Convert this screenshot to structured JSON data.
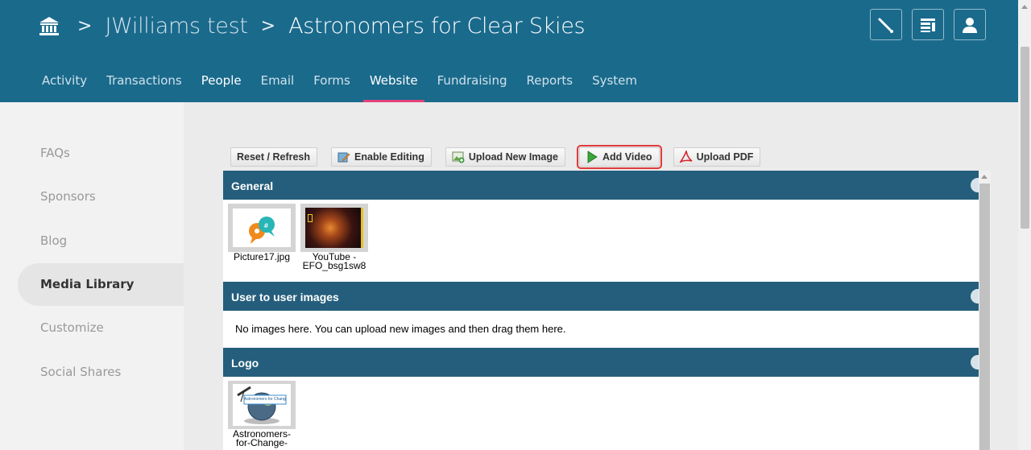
{
  "header": {
    "breadcrumbs": [
      "JWilliams test",
      "Astronomers for Clear Skies"
    ],
    "separator": ">",
    "icons": [
      "brush-icon",
      "layout-icon",
      "user-icon"
    ]
  },
  "nav": {
    "items": [
      "Activity",
      "Transactions",
      "People",
      "Email",
      "Forms",
      "Website",
      "Fundraising",
      "Reports",
      "System"
    ],
    "active": "Website"
  },
  "sidebar": {
    "items": [
      "FAQs",
      "Sponsors",
      "Blog",
      "Media Library",
      "Customize",
      "Social Shares"
    ],
    "active": "Media Library"
  },
  "toolbar": {
    "reset_label": "Reset / Refresh",
    "edit_label": "Enable Editing",
    "upload_image_label": "Upload New Image",
    "add_video_label": "Add Video",
    "upload_pdf_label": "Upload PDF"
  },
  "sections": {
    "general": {
      "title": "General",
      "items": [
        {
          "name": "Picture17.jpg"
        },
        {
          "name_line1": "YouTube -",
          "name_line2": "EFO_bsg1sw8"
        }
      ]
    },
    "user_images": {
      "title": "User to user images",
      "empty_text": "No images here. You can upload new images and then drag them here."
    },
    "logo": {
      "title": "Logo",
      "items": [
        {
          "name_line1": "Astronomers-",
          "name_line2": "for-Change-",
          "logo_text": "Astronomers for Change"
        }
      ]
    }
  },
  "colors": {
    "header_bg": "#1a6a8c",
    "section_header_bg": "#245e7c",
    "active_underline": "#e0427a",
    "highlight_outline": "#e03a3a"
  }
}
